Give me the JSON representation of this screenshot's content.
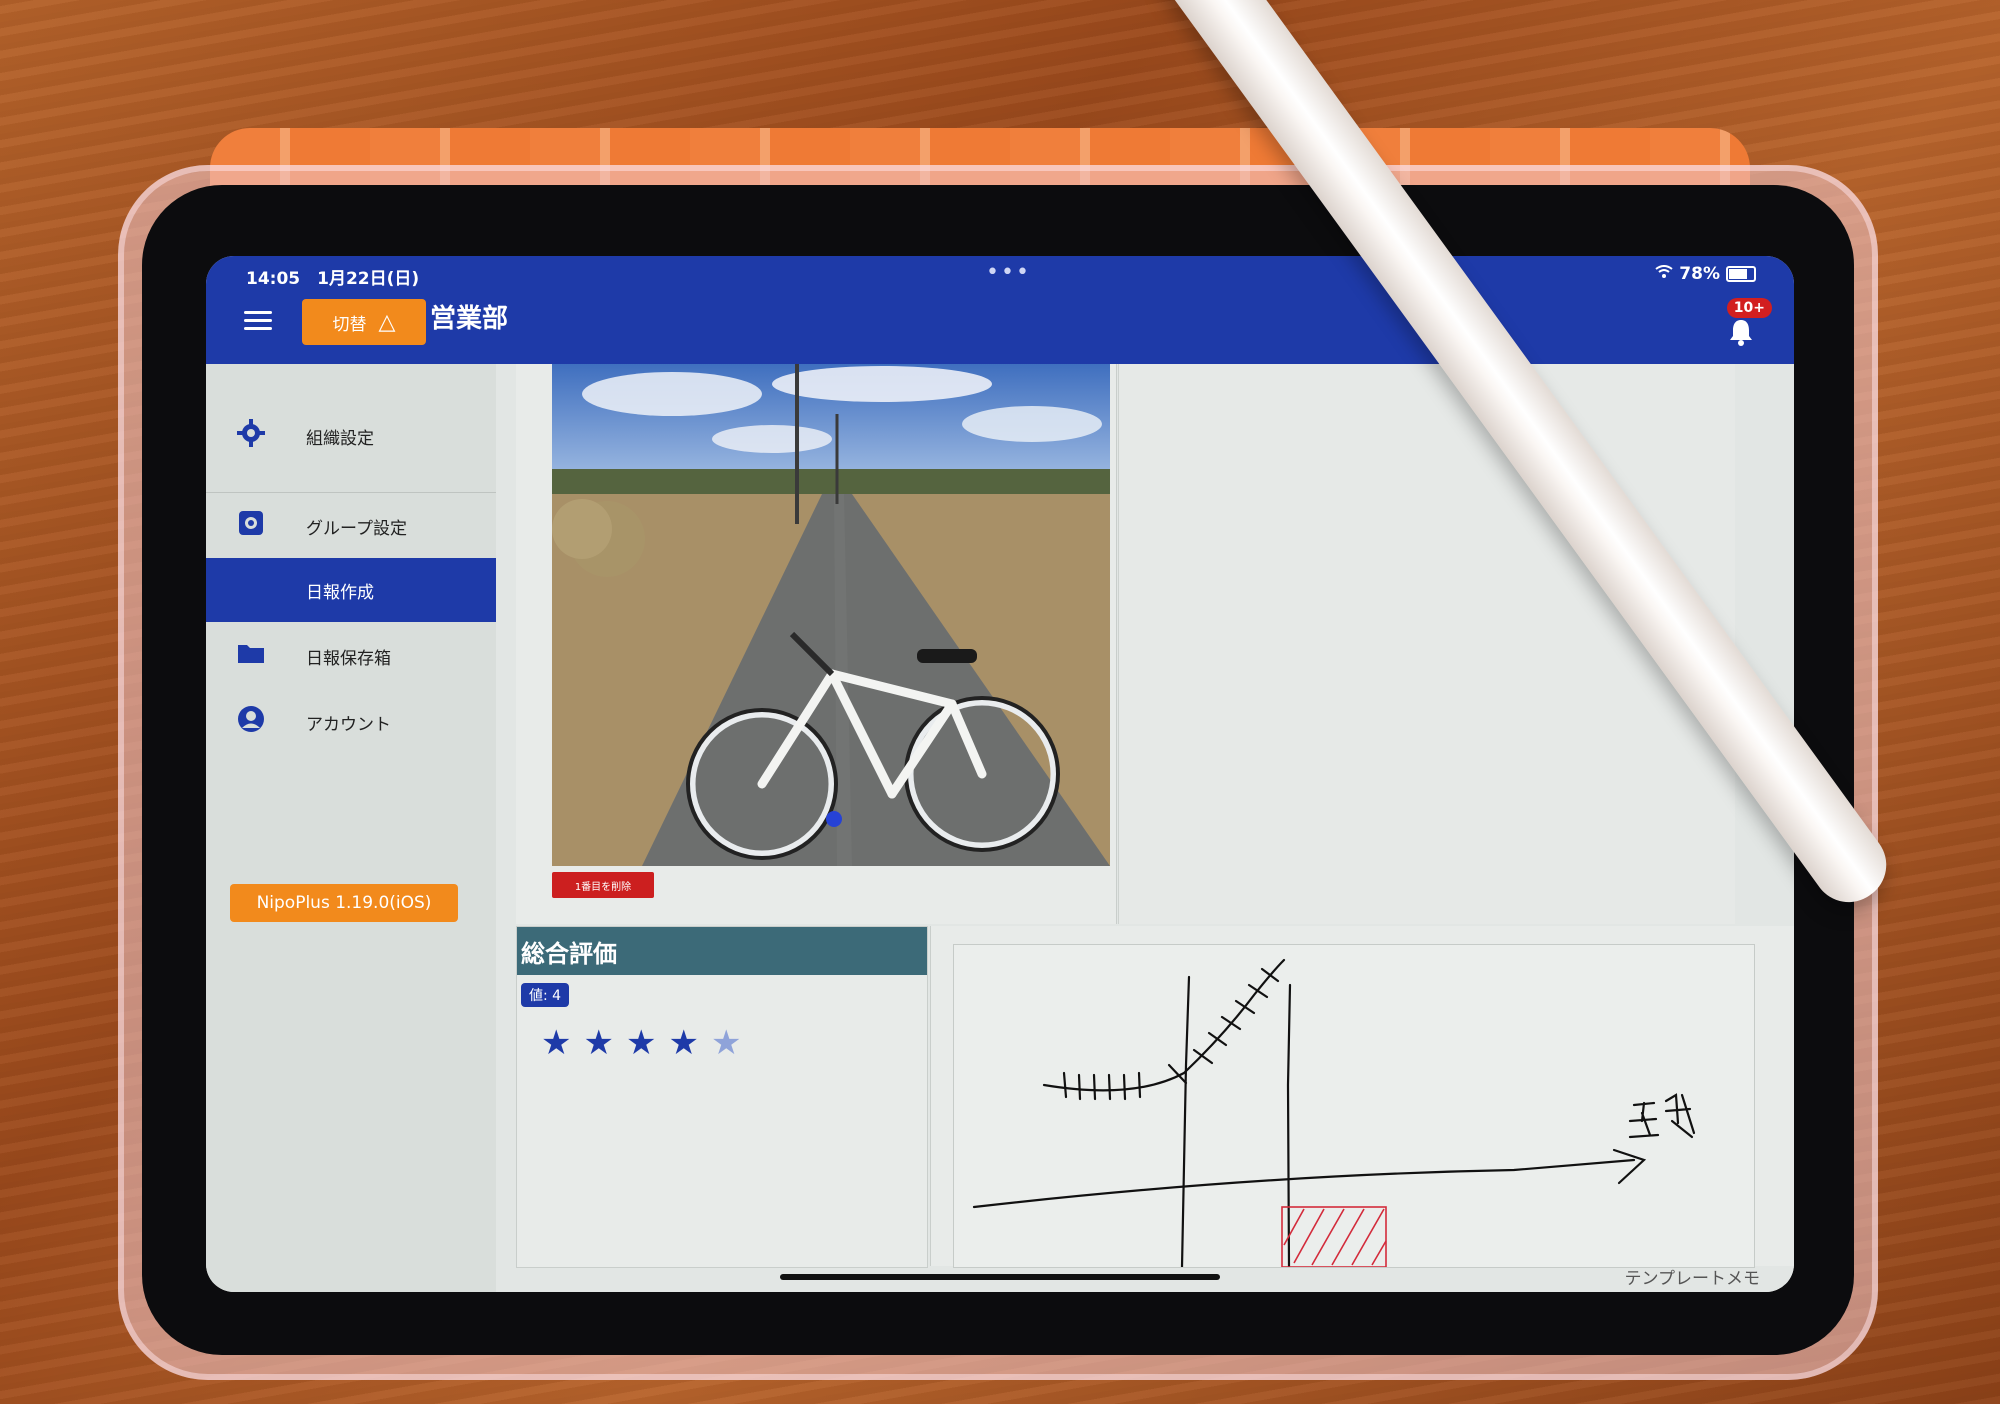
{
  "status_bar": {
    "time_date": "14:05　1月22日(日)",
    "dots": "•••",
    "battery": "78%"
  },
  "app_bar": {
    "switch_label": "切替",
    "switch_icon": "△",
    "org_name": "営業部",
    "notification_badge": "10+"
  },
  "sidebar": {
    "items": [
      {
        "icon": "gear-icon",
        "label": "組織設定"
      },
      {
        "icon": "group-gear-icon",
        "label": "グループ設定"
      },
      {
        "icon": "none",
        "label": "日報作成",
        "active": true
      },
      {
        "icon": "folder-icon",
        "label": "日報保存箱"
      },
      {
        "icon": "account-icon",
        "label": "アカウント"
      }
    ],
    "version_label": "NipoPlus 1.19.0(iOS)"
  },
  "main": {
    "photo_delete_label": "1番目を削除",
    "rating": {
      "title": "総合評価",
      "value_label": "値: 4",
      "value": 4,
      "max": 5
    },
    "memo_label": "テンプレートメモ"
  },
  "colors": {
    "primary": "#1e3aa8",
    "accent": "#f28a1c",
    "danger": "#cc1f1f",
    "rating_header": "#3c6a78",
    "star_filled": "#1e3aa8",
    "star_empty": "#8fa3d9"
  }
}
